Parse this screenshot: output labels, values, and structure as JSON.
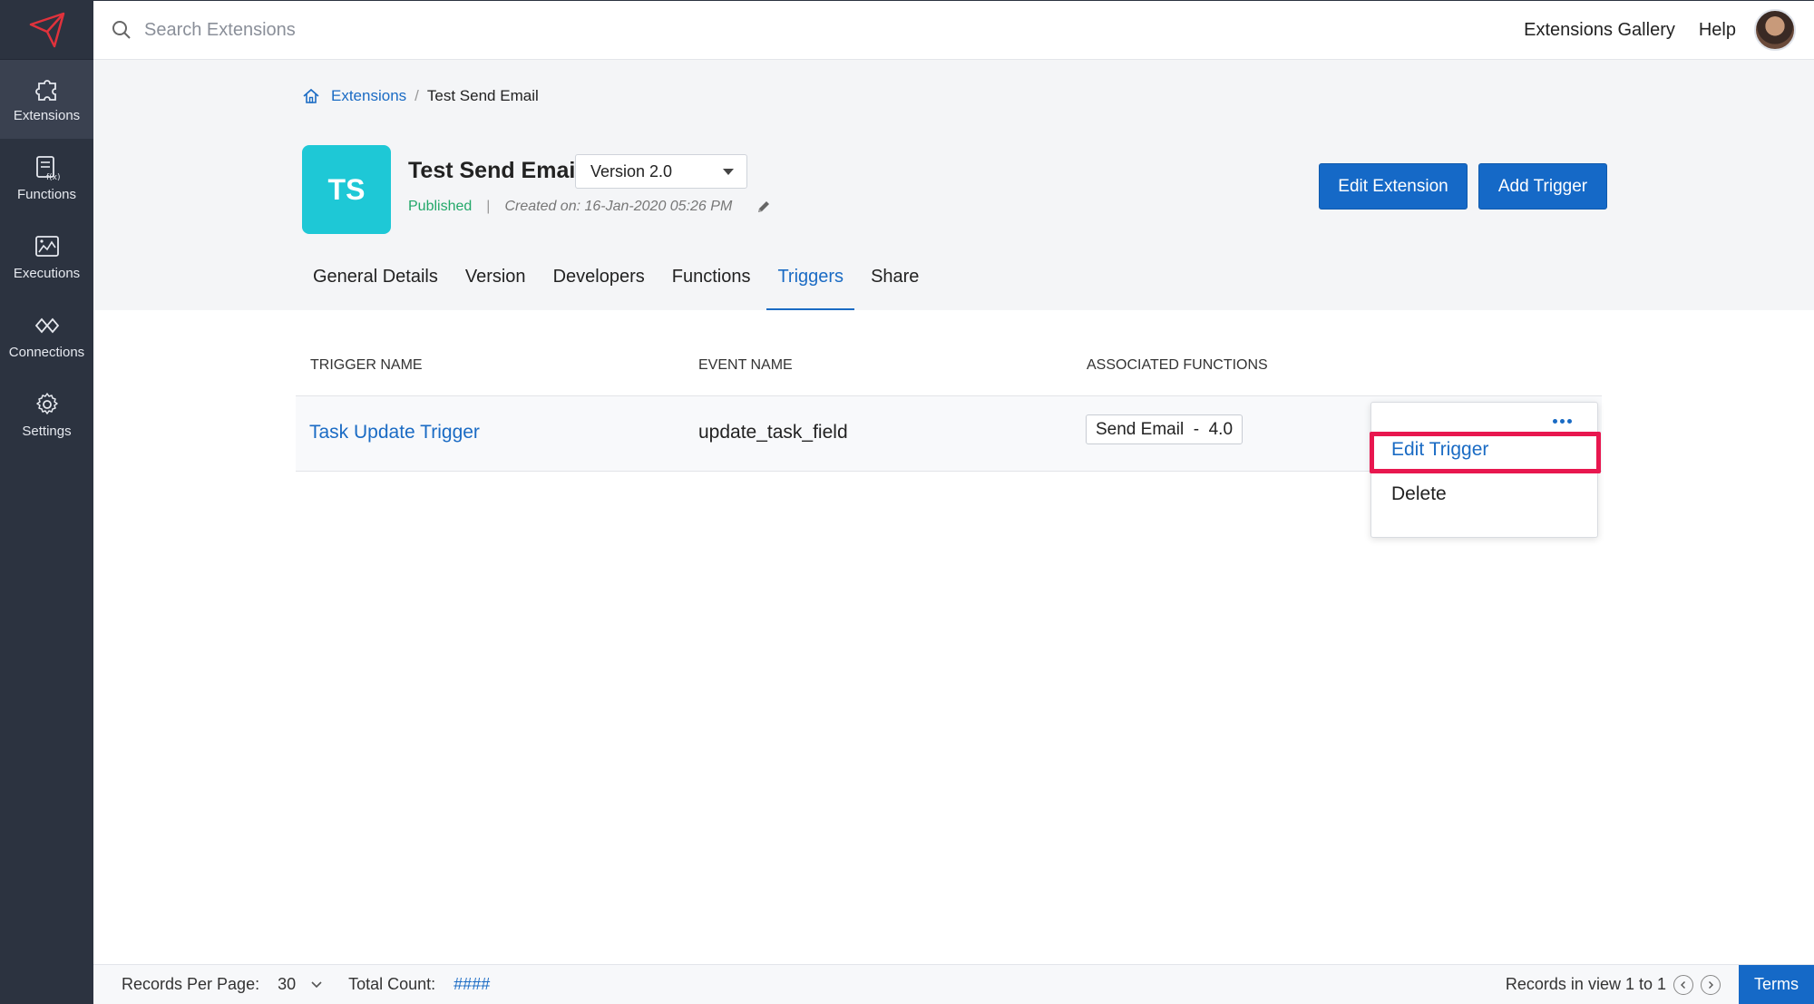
{
  "sidebar": {
    "items": [
      {
        "label": "Extensions",
        "icon": "puzzle-icon",
        "active": true
      },
      {
        "label": "Functions",
        "icon": "function-icon",
        "active": false
      },
      {
        "label": "Executions",
        "icon": "executions-icon",
        "active": false
      },
      {
        "label": "Connections",
        "icon": "connections-icon",
        "active": false
      },
      {
        "label": "Settings",
        "icon": "gear-icon",
        "active": false
      }
    ]
  },
  "topbar": {
    "search_placeholder": "Search Extensions",
    "gallery_link": "Extensions Gallery",
    "help_link": "Help"
  },
  "breadcrumb": {
    "root": "Extensions",
    "separator": "/",
    "current": "Test Send Email"
  },
  "extension": {
    "initials": "TS",
    "name": "Test Send Email",
    "version": "Version 2.0",
    "status": "Published",
    "status_separator": "|",
    "created": "Created on: 16-Jan-2020 05:26 PM"
  },
  "actions": {
    "edit_extension": "Edit Extension",
    "add_trigger": "Add Trigger"
  },
  "tabs": [
    {
      "label": "General Details",
      "active": false
    },
    {
      "label": "Version",
      "active": false
    },
    {
      "label": "Developers",
      "active": false
    },
    {
      "label": "Functions",
      "active": false
    },
    {
      "label": "Triggers",
      "active": true
    },
    {
      "label": "Share",
      "active": false
    }
  ],
  "table": {
    "columns": [
      "TRIGGER NAME",
      "EVENT NAME",
      "ASSOCIATED FUNCTIONS"
    ],
    "rows": [
      {
        "trigger_name": "Task Update Trigger",
        "event_name": "update_task_field",
        "function": "Send Email  -  4.0"
      }
    ]
  },
  "row_menu": {
    "edit": "Edit Trigger",
    "delete": "Delete"
  },
  "footer": {
    "records_per_page_label": "Records Per Page:",
    "records_per_page_value": "30",
    "total_count_label": "Total Count:",
    "total_count_value": "####",
    "records_in_view": "Records in view 1 to 1",
    "terms": "Terms"
  },
  "colors": {
    "accent": "#1569c7",
    "sidebar": "#2c3340",
    "logo_tile": "#1ec8d6",
    "published": "#23a86a",
    "highlight": "#e8174f"
  }
}
